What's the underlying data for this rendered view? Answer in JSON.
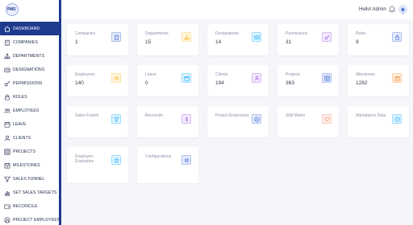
{
  "app": {
    "logo_text": "PMS"
  },
  "header": {
    "greeting": "Hello! Admin"
  },
  "sidebar": {
    "items": [
      {
        "label": "DASHBOARD",
        "icon": "home-icon"
      },
      {
        "label": "COMPANIES",
        "icon": "building-icon"
      },
      {
        "label": "DEPARTMENTS",
        "icon": "sitemap-icon"
      },
      {
        "label": "DESIGNATIONS",
        "icon": "id-card-icon"
      },
      {
        "label": "PERMISSIONS",
        "icon": "key-icon"
      },
      {
        "label": "ROLES",
        "icon": "lock-icon"
      },
      {
        "label": "EMPLOYEES",
        "icon": "users-icon"
      },
      {
        "label": "LEAVE",
        "icon": "calendar-icon"
      },
      {
        "label": "CLIENTS",
        "icon": "user-icon"
      },
      {
        "label": "PROJECTS",
        "icon": "grid-icon"
      },
      {
        "label": "MILESTONES",
        "icon": "calendar-check-icon"
      },
      {
        "label": "SALES FUNNEL",
        "icon": "funnel-icon"
      },
      {
        "label": "SET SALES TARGETS",
        "icon": "chart-icon"
      },
      {
        "label": "RECONCILE",
        "icon": "wallet-icon"
      },
      {
        "label": "PROJECT EMPLOYEES",
        "icon": "github-icon"
      }
    ]
  },
  "cards": [
    {
      "title": "Companies",
      "value": "1",
      "color": "#3f6ad8",
      "icon": "building-icon"
    },
    {
      "title": "Departments",
      "value": "15",
      "color": "#f7b924",
      "icon": "sitemap-icon"
    },
    {
      "title": "Designations",
      "value": "14",
      "color": "#16aaff",
      "icon": "id-card-icon"
    },
    {
      "title": "Permissions",
      "value": "31",
      "color": "#a45de8",
      "icon": "key-icon"
    },
    {
      "title": "Roles",
      "value": "9",
      "color": "#3f6ad8",
      "icon": "lock-icon"
    },
    {
      "title": "Employees",
      "value": "140",
      "color": "#f7b924",
      "icon": "users-icon"
    },
    {
      "title": "Leave",
      "value": "0",
      "color": "#16aaff",
      "icon": "calendar-icon"
    },
    {
      "title": "Clients",
      "value": "194",
      "color": "#a45de8",
      "icon": "user-icon"
    },
    {
      "title": "Projects",
      "value": "363",
      "color": "#3f6ad8",
      "icon": "grid-icon"
    },
    {
      "title": "Milestones",
      "value": "1282",
      "color": "#f78a24",
      "icon": "calendar-check-icon"
    },
    {
      "title": "Sales Funnel",
      "value": "",
      "color": "#16aaff",
      "icon": "funnel-icon"
    },
    {
      "title": "Reconcile",
      "value": "",
      "color": "#a45de8",
      "icon": "dollar-icon"
    },
    {
      "title": "Project Employees",
      "value": "",
      "color": "#3f6ad8",
      "icon": "github-icon"
    },
    {
      "title": "Skill Matrix",
      "value": "",
      "color": "#f78a6a",
      "icon": "heart-icon"
    },
    {
      "title": "Attendance Data",
      "value": "",
      "color": "#16aaff",
      "icon": "clock-icon"
    },
    {
      "title": "Employee Evaluation",
      "value": "",
      "color": "#16aaff",
      "icon": "star-icon"
    },
    {
      "title": "Configurations",
      "value": "",
      "color": "#3f6ad8",
      "icon": "gear-icon"
    }
  ]
}
